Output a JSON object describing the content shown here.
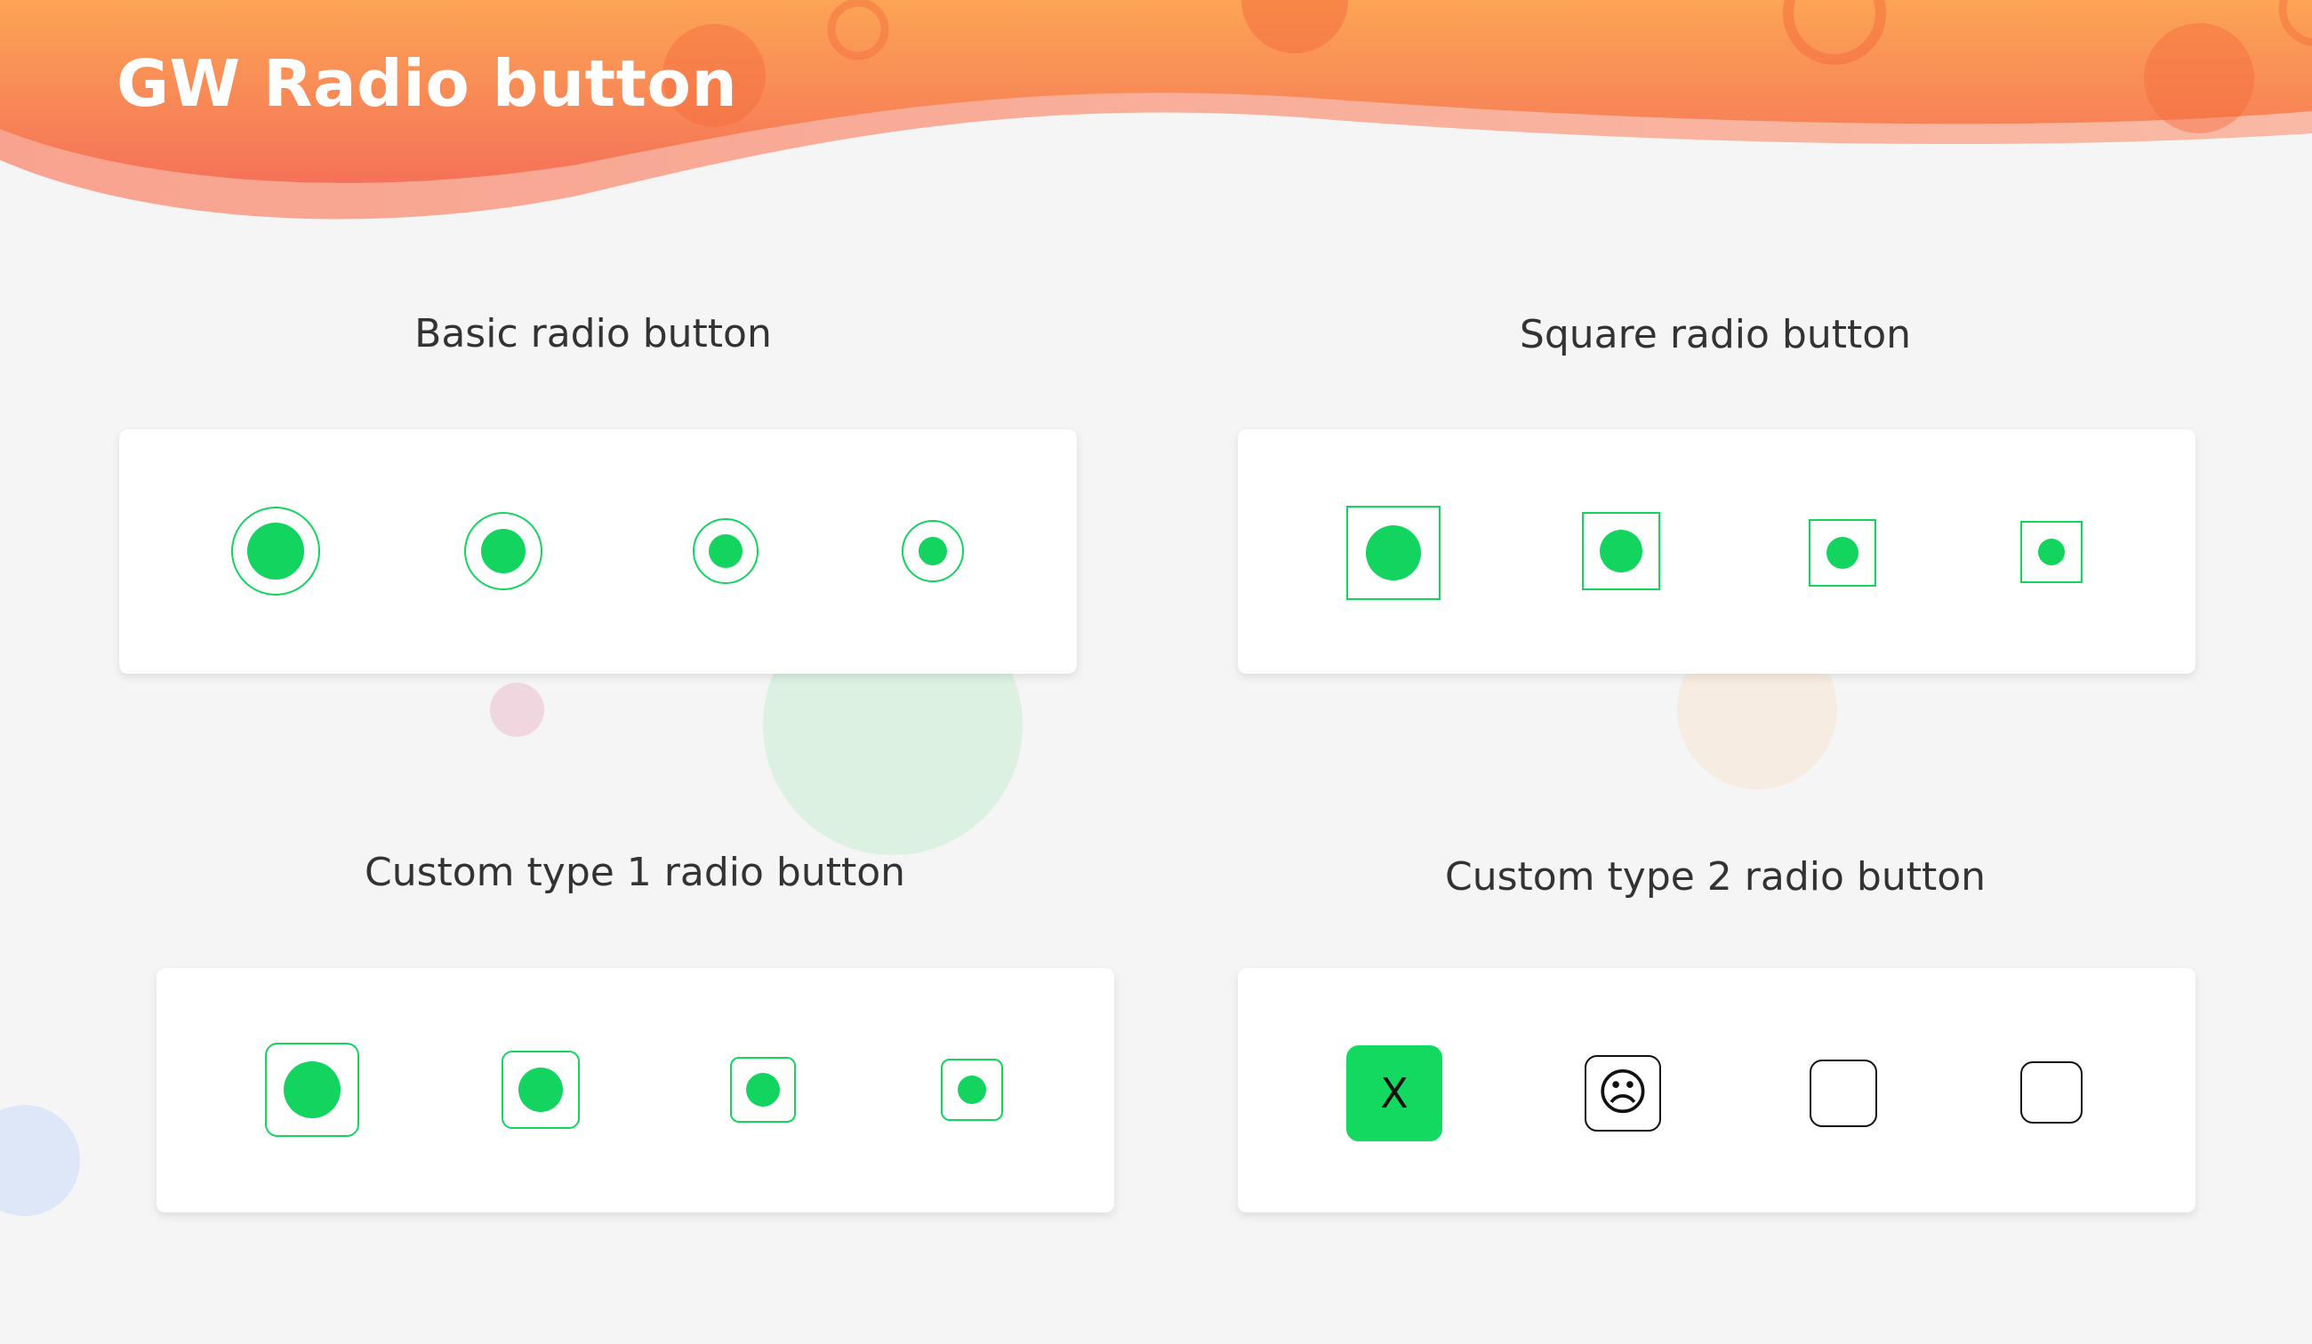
{
  "header": {
    "title": "GW Radio button"
  },
  "colors": {
    "accent_green": "#14d460",
    "header_orange": "#fb8c4c",
    "header_pink": "#f5a79b",
    "background": "#f5f5f5"
  },
  "sections": {
    "basic": {
      "title": "Basic radio button",
      "shape": "circle",
      "state": "checked"
    },
    "square": {
      "title": "Square radio button",
      "shape": "square",
      "state": "checked"
    },
    "custom1": {
      "title": "Custom type 1 radio button",
      "shape": "rounded-square",
      "state": "checked"
    },
    "custom2": {
      "title": "Custom type 2 radio button",
      "items": [
        {
          "label": "X",
          "state": "checked"
        },
        {
          "label": "☹",
          "state": "sad-face"
        },
        {
          "label": "",
          "state": "unchecked"
        },
        {
          "label": "",
          "state": "unchecked"
        }
      ]
    }
  }
}
